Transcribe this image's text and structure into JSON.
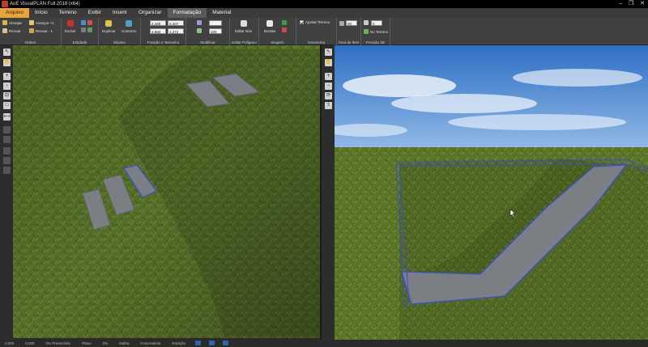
{
  "window": {
    "title": "AuE VisualPLAN Full 2018 (x64)",
    "controls": {
      "minimize": "–",
      "restore": "❐",
      "close": "✕"
    }
  },
  "menu": {
    "tabs": [
      "Arquivo",
      "Início",
      "Terreno",
      "Exibir",
      "Inserir",
      "Organizar",
      "Formatação",
      "Material"
    ],
    "active": "Formatação"
  },
  "ribbon": {
    "ordem": {
      "label": "Ordem",
      "arranjar": "Arranjar",
      "recuar": "Recuar",
      "avancar": "Avançar +1",
      "recuar1": "Recuar - 1"
    },
    "entidade": {
      "label": "Entidade",
      "excluir": "Excluir"
    },
    "elipses": {
      "label": "Elipses",
      "duplicar": "Duplicar",
      "contorno": "Contorno"
    },
    "posicao": {
      "label": "Posição e Tamanho",
      "x": "2,180",
      "y": "4,650",
      "w": "3,407",
      "h": "1,272"
    },
    "modificar": {
      "label": "Modificar",
      "value": "100"
    },
    "poligono": {
      "label": "Editar Polígono",
      "editar_nos": "Editar Nós"
    },
    "imagem": {
      "label": "Imagem",
      "bordas": "Bordas"
    },
    "geometria": {
      "label": "Geometria",
      "ajustar_terreno": "Ajustar Terreno"
    },
    "area": {
      "label": "Área de Item",
      "value": "00"
    },
    "posicao3d": {
      "label": "Posição 3D",
      "value": "0",
      "no_terreno": "No Terreno"
    }
  },
  "status": {
    "items": [
      "0,000",
      "0,000",
      "0% Preenchido",
      "Plano",
      "0%",
      "Malha",
      "Fotorrealista",
      "Rotação"
    ]
  },
  "colors": {
    "file_tab": "#e8a33a",
    "menu_bg": "#3b3b3b",
    "ribbon_bg": "#404040",
    "selection": "#3a4fd0",
    "grass": "#4f6b24",
    "path": "#7b7f83",
    "sky": "#4a86cf"
  }
}
